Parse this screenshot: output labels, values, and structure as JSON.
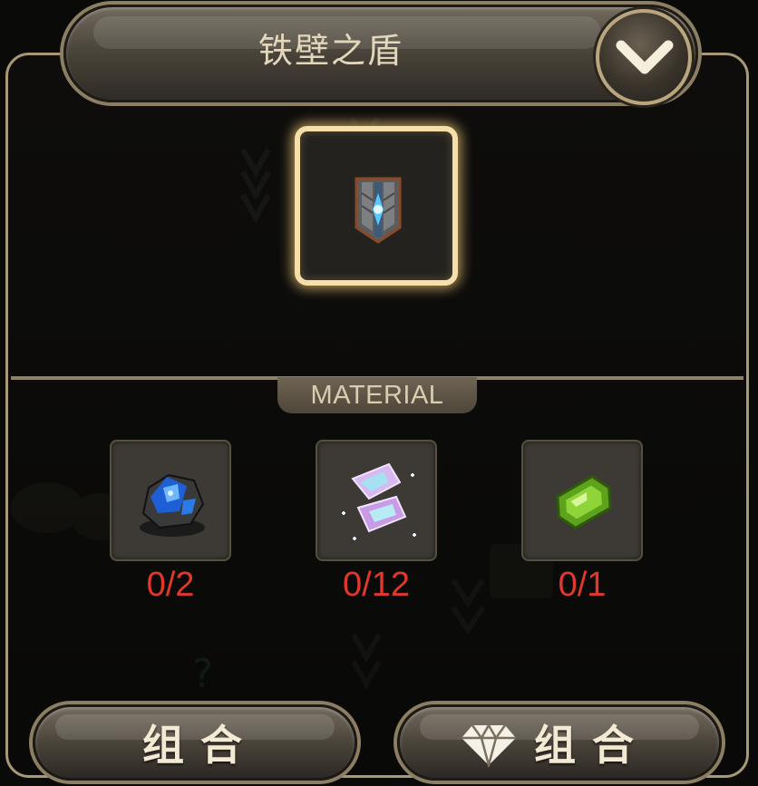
{
  "title": "铁壁之盾",
  "icons": {
    "collapse": "chevron-down-icon",
    "crafted_item": "iron-wall-shield-icon",
    "gem_premium": "diamond-icon"
  },
  "section_label": "MATERIAL",
  "materials": [
    {
      "icon": "blue-ore-icon",
      "count": "0/2"
    },
    {
      "icon": "crystal-shard-icon",
      "count": "0/12"
    },
    {
      "icon": "green-gem-icon",
      "count": "0/1"
    }
  ],
  "buttons": {
    "combine": "组合",
    "combine_with_gem": "组合"
  },
  "colors": {
    "frame": "#a89876",
    "slot_glow": "#f6dfa9",
    "count_text": "#e2382b",
    "title_text": "#e3d7bb"
  }
}
